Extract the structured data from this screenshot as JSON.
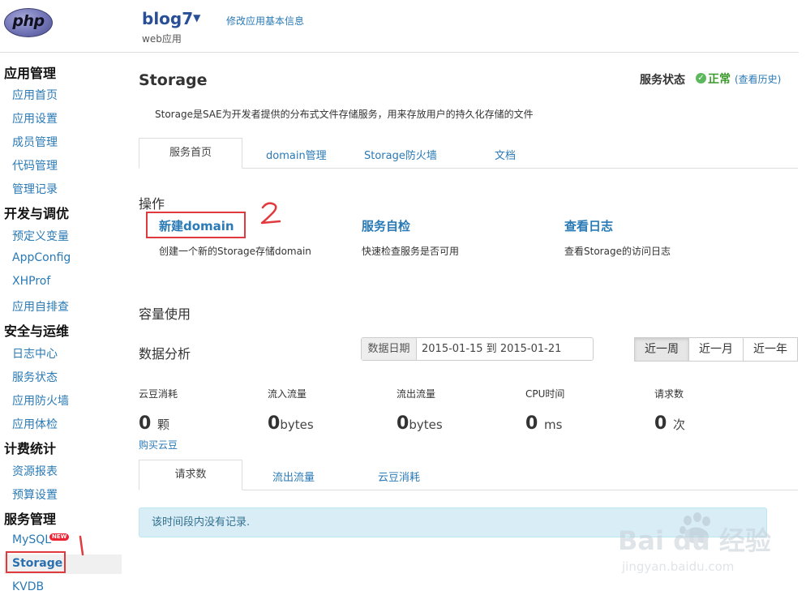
{
  "header": {
    "logo_text": "php",
    "app_name": "blog7",
    "app_caret": "▼",
    "app_type": "web应用",
    "edit_link": "修改应用基本信息"
  },
  "sidebar": {
    "groups": [
      {
        "title": "应用管理",
        "items": [
          "应用首页",
          "应用设置",
          "成员管理",
          "代码管理",
          "管理记录"
        ]
      },
      {
        "title": "开发与调优",
        "items": [
          "预定义变量",
          "AppConfig",
          "XHProf",
          "应用自排查"
        ]
      },
      {
        "title": "安全与运维",
        "items": [
          "日志中心",
          "服务状态",
          "应用防火墙",
          "应用体检"
        ]
      },
      {
        "title": "计费统计",
        "items": [
          "资源报表",
          "预算设置"
        ]
      },
      {
        "title": "服务管理",
        "items": [
          "MySQL",
          "Storage",
          "KVDB"
        ]
      }
    ],
    "new_badge": "NEW",
    "active_item": "Storage"
  },
  "main": {
    "title": "Storage",
    "service_status_label": "服务状态",
    "service_status_value": "正常",
    "history_link": "(查看历史)",
    "description": "Storage是SAE为开发者提供的分布式文件存储服务，用来存放用户的持久化存储的文件",
    "tabs": [
      "服务首页",
      "domain管理",
      "Storage防火墙",
      "文档"
    ],
    "ops_title": "操作",
    "ops": [
      {
        "title": "新建domain",
        "desc": "创建一个新的Storage存储domain"
      },
      {
        "title": "服务自检",
        "desc": "快速检查服务是否可用"
      },
      {
        "title": "查看日志",
        "desc": "查看Storage的访问日志"
      }
    ],
    "capacity_title": "容量使用",
    "analysis_title": "数据分析",
    "date_label": "数据日期",
    "date_range": "2015-01-15 到 2015-01-21",
    "range_buttons": [
      "近一周",
      "近一月",
      "近一年"
    ],
    "stats": [
      {
        "label": "云豆消耗",
        "value": "0",
        "unit": "颗"
      },
      {
        "label": "流入流量",
        "value": "0",
        "unit": "bytes"
      },
      {
        "label": "流出流量",
        "value": "0",
        "unit": "bytes"
      },
      {
        "label": "CPU时间",
        "value": "0",
        "unit": "ms"
      },
      {
        "label": "请求数",
        "value": "0",
        "unit": "次"
      }
    ],
    "buy_link": "购买云豆",
    "chart_tabs": [
      "请求数",
      "流出流量",
      "云豆消耗"
    ],
    "empty_alert": "该时间段内没有记录."
  },
  "annotations": {
    "mark_1": "1",
    "mark_2": "2"
  },
  "watermark": {
    "brand": "Bai du 经验",
    "url": "jingyan.baidu.com"
  },
  "colors": {
    "link": "#2a7ab6",
    "status_ok": "#3c9a2d",
    "highlight_box": "#e0393e",
    "alert_bg": "#d9edf7"
  }
}
